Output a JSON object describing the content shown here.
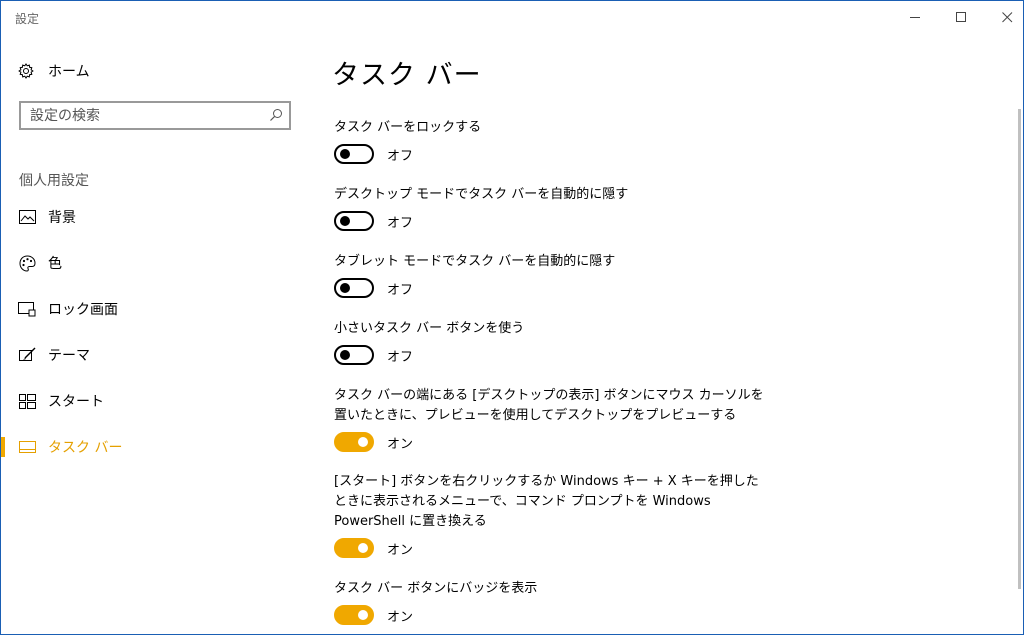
{
  "window": {
    "title": "設定"
  },
  "sidebar": {
    "home_label": "ホーム",
    "search_placeholder": "設定の検索",
    "section_label": "個人用設定",
    "items": [
      {
        "label": "背景",
        "icon": "picture-icon"
      },
      {
        "label": "色",
        "icon": "palette-icon"
      },
      {
        "label": "ロック画面",
        "icon": "lock-screen-icon"
      },
      {
        "label": "テーマ",
        "icon": "theme-brush-icon"
      },
      {
        "label": "スタート",
        "icon": "start-grid-icon"
      },
      {
        "label": "タスク バー",
        "icon": "taskbar-icon",
        "active": true
      }
    ]
  },
  "main": {
    "title": "タスク バー",
    "settings": [
      {
        "desc": "タスク バーをロックする",
        "state": "オフ",
        "on": false
      },
      {
        "desc": "デスクトップ モードでタスク バーを自動的に隠す",
        "state": "オフ",
        "on": false
      },
      {
        "desc": "タブレット モードでタスク バーを自動的に隠す",
        "state": "オフ",
        "on": false
      },
      {
        "desc": "小さいタスク バー ボタンを使う",
        "state": "オフ",
        "on": false
      },
      {
        "desc": "タスク バーの端にある [デスクトップの表示] ボタンにマウス カーソルを置いたときに、プレビューを使用してデスクトップをプレビューする",
        "state": "オン",
        "on": true
      },
      {
        "desc": "[スタート] ボタンを右クリックするか Windows キー + X キーを押したときに表示されるメニューで、コマンド プロンプトを Windows PowerShell に置き換える",
        "state": "オン",
        "on": true
      },
      {
        "desc": "タスク バー ボタンにバッジを表示",
        "state": "オン",
        "on": true
      }
    ]
  },
  "colors": {
    "accent": "#f0a800",
    "toggle_off": "#000000",
    "window_border": "#1a5fb4"
  }
}
